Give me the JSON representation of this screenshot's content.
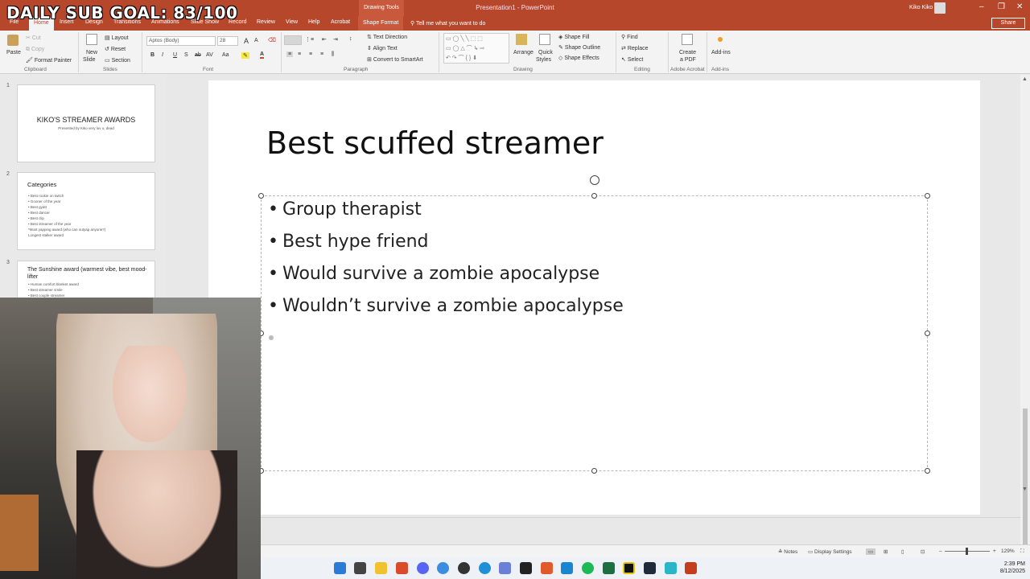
{
  "overlay": {
    "sub_goal": "DAILY SUB GOAL: 83/100"
  },
  "titlebar": {
    "drawing_tools": "Drawing Tools",
    "doc_title": "Presentation1  -  PowerPoint",
    "user_name": "Kiko Kiko"
  },
  "tabs": {
    "items": [
      "File",
      "Home",
      "Insert",
      "Design",
      "Transitions",
      "Animations",
      "Slide Show",
      "Record",
      "Review",
      "View",
      "Help",
      "Acrobat",
      "Shape Format"
    ],
    "active": "Home",
    "tell_me": "Tell me what you want to do",
    "share": "Share"
  },
  "ribbon": {
    "clipboard": {
      "paste": "Paste",
      "cut": "Cut",
      "copy": "Copy",
      "format_painter": "Format Painter",
      "group": "Clipboard"
    },
    "slides": {
      "new_slide": "New",
      "new_slide2": "Slide",
      "layout": "Layout",
      "reset": "Reset",
      "section": "Section",
      "group": "Slides"
    },
    "font": {
      "font_name": "Aptos (Body)",
      "font_size": "28",
      "group": "Font"
    },
    "paragraph": {
      "text_direction": "Text Direction",
      "align_text": "Align Text",
      "convert_smartart": "Convert to SmartArt",
      "group": "Paragraph"
    },
    "drawing": {
      "arrange": "Arrange",
      "quick_styles": "Quick",
      "quick_styles2": "Styles",
      "shape_fill": "Shape Fill",
      "shape_outline": "Shape Outline",
      "shape_effects": "Shape Effects",
      "group": "Drawing"
    },
    "editing": {
      "find": "Find",
      "replace": "Replace",
      "select": "Select",
      "group": "Editing"
    },
    "acrobat": {
      "create_pdf": "Create",
      "create_pdf2": "a PDF",
      "group": "Adobe Acrobat"
    },
    "addins": {
      "addins": "Add-ins",
      "group": "Add-ins"
    }
  },
  "slides_panel": {
    "slide1": {
      "num": "1",
      "title": "KIKO'S STREAMER AWARDS",
      "subtitle": "Presented by Kiko very luv u, dead"
    },
    "slide2": {
      "num": "2",
      "title": "Categories",
      "lines": [
        "• Best rookie on twitch",
        "• Gooner of the year",
        "• Best gyatt",
        "• Best dancer",
        "• Best clip",
        "• Best streamer of the year",
        "*Most yapping award (who can outyap anyone?)",
        "Longest stalker award"
      ]
    },
    "slide3": {
      "num": "3",
      "title": "The Sunshine award (warmest vibe, best mood-lifter",
      "lines": [
        "• Human comfort blanket award",
        "• Best streamer smile",
        "• Best couple streamer"
      ]
    }
  },
  "slide": {
    "title": "Best scuffed streamer",
    "bullets": [
      "Group therapist",
      "Best hype friend",
      "Would survive a zombie apocalypse",
      "Wouldn’t survive a zombie apocalypse"
    ]
  },
  "statusbar": {
    "notes": "Notes",
    "display_settings": "Display Settings",
    "zoom": "129%"
  },
  "taskbar": {
    "time": "2:39 PM",
    "date": "8/12/2025"
  }
}
